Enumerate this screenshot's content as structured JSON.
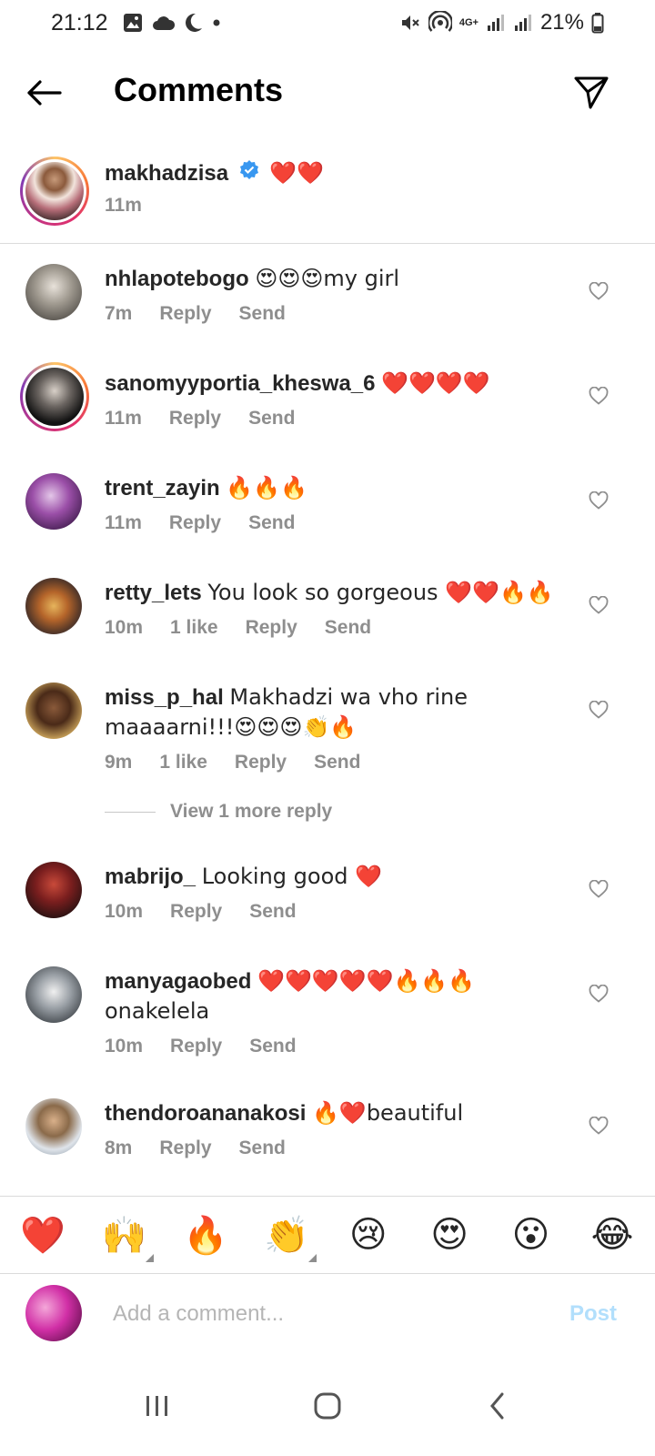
{
  "status_bar": {
    "time": "21:12",
    "network_label": "4G+",
    "battery": "21%"
  },
  "header": {
    "title": "Comments"
  },
  "caption": {
    "username": "makhadzisa",
    "text": "❤️❤️",
    "time": "11m"
  },
  "comments": [
    {
      "username": "nhlapotebogo",
      "text": "😍😍😍my girl",
      "time": "7m",
      "likes": "",
      "reply": "Reply",
      "send": "Send"
    },
    {
      "username": "sanomyyportia_kheswa_6",
      "text": "❤️❤️❤️❤️",
      "time": "11m",
      "likes": "",
      "reply": "Reply",
      "send": "Send"
    },
    {
      "username": "trent_zayin",
      "text": "🔥🔥🔥",
      "time": "11m",
      "likes": "",
      "reply": "Reply",
      "send": "Send"
    },
    {
      "username": "retty_lets",
      "text": "You look so gorgeous ❤️❤️🔥🔥",
      "time": "10m",
      "likes": "1 like",
      "reply": "Reply",
      "send": "Send"
    },
    {
      "username": "miss_p_hal",
      "text": "Makhadzi wa vho rine maaaarni!!!😍😍😍👏🔥",
      "time": "9m",
      "likes": "1 like",
      "reply": "Reply",
      "send": "Send"
    },
    {
      "username": "mabrijo_",
      "text": "Looking good ❤️",
      "time": "10m",
      "likes": "",
      "reply": "Reply",
      "send": "Send"
    },
    {
      "username": "manyagaobed",
      "text": "❤️❤️❤️❤️❤️🔥🔥🔥 onakelela",
      "time": "10m",
      "likes": "",
      "reply": "Reply",
      "send": "Send"
    },
    {
      "username": "thendoroananakosi",
      "text": "🔥❤️beautiful",
      "time": "8m",
      "likes": "",
      "reply": "Reply",
      "send": "Send"
    }
  ],
  "view_more": "View 1 more reply",
  "emoji_bar": [
    "❤️",
    "🙌",
    "🔥",
    "👏",
    "😢",
    "😍",
    "😮",
    "😂"
  ],
  "input": {
    "placeholder": "Add a comment...",
    "post_label": "Post"
  },
  "colors": {
    "link_disabled": "#b2dffc",
    "meta_gray": "#8e8e8e",
    "verified_blue": "#3897f0"
  }
}
